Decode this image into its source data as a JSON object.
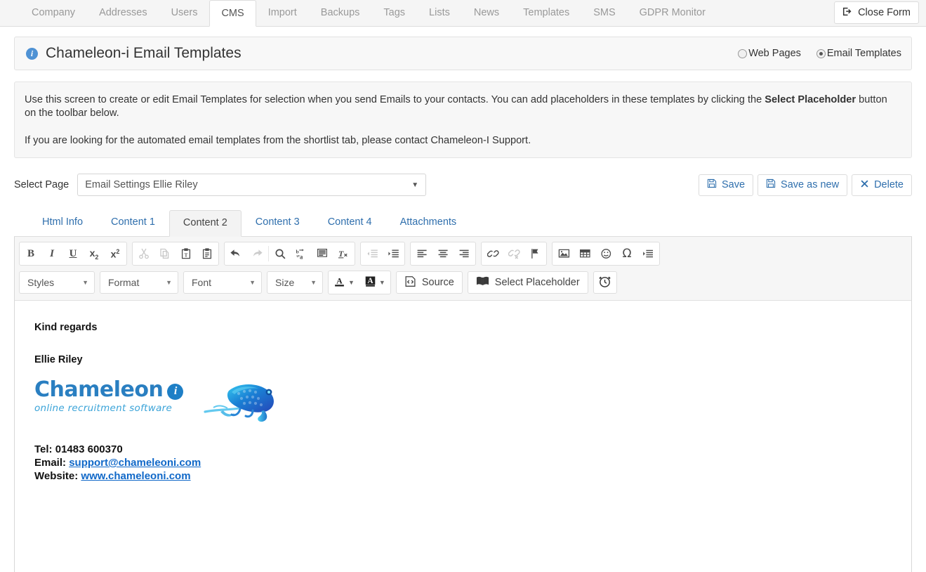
{
  "topnav": {
    "tabs": [
      {
        "label": "Company",
        "active": false
      },
      {
        "label": "Addresses",
        "active": false
      },
      {
        "label": "Users",
        "active": false
      },
      {
        "label": "CMS",
        "active": true
      },
      {
        "label": "Import",
        "active": false
      },
      {
        "label": "Backups",
        "active": false
      },
      {
        "label": "Tags",
        "active": false
      },
      {
        "label": "Lists",
        "active": false
      },
      {
        "label": "News",
        "active": false
      },
      {
        "label": "Templates",
        "active": false
      },
      {
        "label": "SMS",
        "active": false
      },
      {
        "label": "GDPR Monitor",
        "active": false
      }
    ],
    "close_form_label": "Close Form",
    "close_form_icon": "sign-out-icon"
  },
  "header": {
    "info_icon": "info-circle-icon",
    "title": "Chameleon-i Email Templates",
    "radios": [
      {
        "label": "Web Pages",
        "selected": false
      },
      {
        "label": "Email Templates",
        "selected": true
      }
    ]
  },
  "info_panel": {
    "para1_a": "Use this screen to create or edit Email Templates for selection when you send Emails to your contacts. You can add placeholders in these templates by clicking the ",
    "para1_bold": "Select Placeholder",
    "para1_b": " button on the toolbar below.",
    "para2": "If you are looking for the automated email templates from the shortlist tab, please contact Chameleon-I Support."
  },
  "select_page": {
    "label": "Select Page",
    "value": "Email Settings Ellie Riley",
    "caret_icon": "chevron-down-icon"
  },
  "actions": [
    {
      "label": "Save",
      "icon": "floppy-disk-icon",
      "name": "save-button"
    },
    {
      "label": "Save as new",
      "icon": "floppy-disk-icon",
      "name": "save-as-new-button"
    },
    {
      "label": "Delete",
      "icon": "cross-icon",
      "name": "delete-button"
    }
  ],
  "content_tabs": [
    {
      "label": "Html Info",
      "active": false
    },
    {
      "label": "Content 1",
      "active": false
    },
    {
      "label": "Content 2",
      "active": true
    },
    {
      "label": "Content 3",
      "active": false
    },
    {
      "label": "Content 4",
      "active": false
    },
    {
      "label": "Attachments",
      "active": false
    }
  ],
  "toolbar": {
    "row1_groups": [
      [
        "bold",
        "italic",
        "underline",
        "subscript",
        "superscript"
      ],
      [
        "cut-disabled",
        "copy-disabled",
        "paste-text",
        "paste-word"
      ],
      [
        "undo",
        "redo-disabled",
        "find",
        "replace",
        "select-all",
        "remove-format"
      ],
      [
        "outdent-disabled",
        "indent"
      ],
      [
        "align-left",
        "align-center",
        "align-right"
      ],
      [
        "link",
        "unlink-disabled",
        "anchor"
      ],
      [
        "image",
        "table",
        "smiley",
        "special-char",
        "page-break"
      ]
    ],
    "combos": [
      {
        "label": "Styles",
        "name": "styles-dropdown"
      },
      {
        "label": "Format",
        "name": "format-dropdown"
      },
      {
        "label": "Font",
        "name": "font-dropdown"
      },
      {
        "label": "Size",
        "name": "size-dropdown"
      }
    ],
    "text_color_icon": "text-color-icon",
    "bg_color_icon": "background-color-icon",
    "source_label": "Source",
    "source_icon": "source-code-icon",
    "placeholder_label": "Select Placeholder",
    "placeholder_icon": "book-icon",
    "timer_icon": "alarm-clock-icon"
  },
  "editor_body": {
    "regards": "Kind regards",
    "name": "Ellie Riley",
    "logo": {
      "word": "Chameleon",
      "badge": "i",
      "tagline": "online recruitment software"
    },
    "tel_label": "Tel:",
    "tel_value": "01483 600370",
    "email_label": "Email:",
    "email_value": "support@chameleoni.com",
    "website_label": "Website:",
    "website_value": "www.chameleoni.com"
  },
  "colors": {
    "accent_blue": "#2f6fad",
    "link_blue": "#1068c8",
    "logo_blue": "#2a7fc1",
    "info_icon_blue": "#4f92d4"
  }
}
